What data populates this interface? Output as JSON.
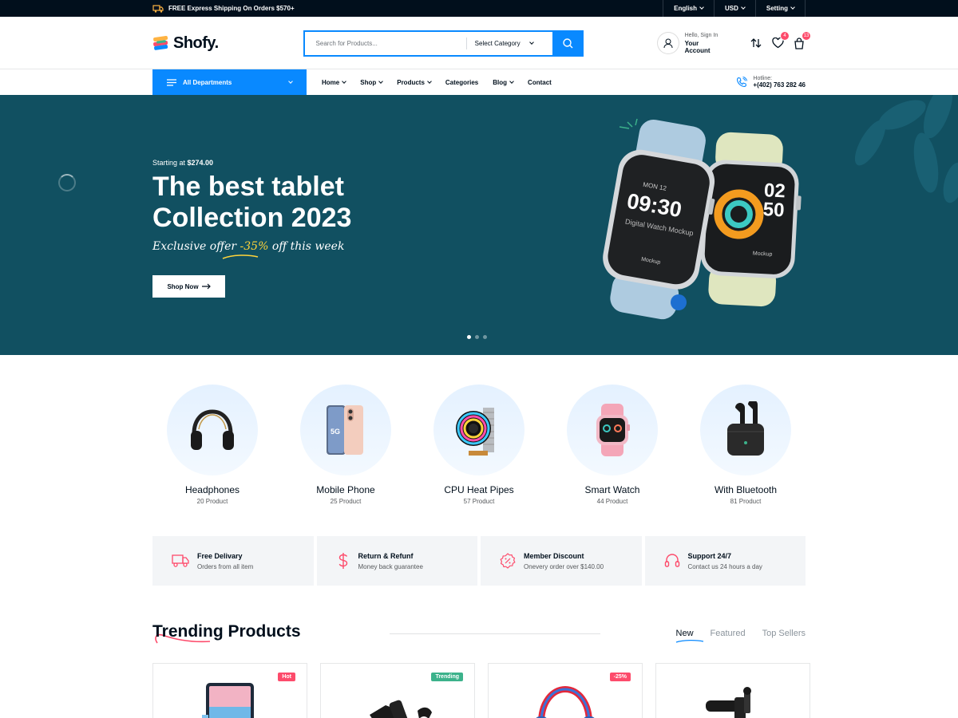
{
  "topbar": {
    "shipping": "FREE Express Shipping On Orders $570+",
    "language": "English",
    "currency": "USD",
    "setting": "Setting"
  },
  "header": {
    "logo": "Shofy.",
    "search_placeholder": "Search for Products...",
    "category": "Select Category",
    "account_line1": "Hello, Sign In",
    "account_line2": "Your Account",
    "wishlist_count": "4",
    "cart_count": "13"
  },
  "nav": {
    "all_departments": "All Departments",
    "menu": [
      "Home",
      "Shop",
      "Products",
      "Categories",
      "Blog",
      "Contact"
    ],
    "hotline_label": "Hotline:",
    "hotline_number": "+(402) 763 282 46"
  },
  "hero": {
    "starting_prefix": "Starting at ",
    "starting_price": "$274.00",
    "title_line1": "The best tablet",
    "title_line2": "Collection 2023",
    "offer_prefix": "Exclusive offer ",
    "offer_pct": "-35%",
    "offer_suffix": " off this week",
    "cta": "Shop Now",
    "watch_left_day": "MON 12",
    "watch_left_time": "09:30",
    "watch_left_caption": "Digital Watch Mockup",
    "watch_left_brand": "Mockup",
    "watch_right_hour": "02",
    "watch_right_min": "50",
    "watch_right_brand": "Mockup",
    "slides": 3,
    "active_slide": 1
  },
  "categories": [
    {
      "name": "Headphones",
      "count": "20 Product",
      "icon": "headphones-icon"
    },
    {
      "name": "Mobile Phone",
      "count": "25 Product",
      "icon": "mobile-phone-icon"
    },
    {
      "name": "CPU Heat Pipes",
      "count": "57 Product",
      "icon": "cpu-cooler-icon"
    },
    {
      "name": "Smart Watch",
      "count": "44 Product",
      "icon": "smart-watch-icon"
    },
    {
      "name": "With Bluetooth",
      "count": "81 Product",
      "icon": "earbuds-icon"
    }
  ],
  "features": [
    {
      "title": "Free Delivary",
      "desc": "Orders from all item",
      "icon": "truck-icon"
    },
    {
      "title": "Return & Refunf",
      "desc": "Money back guarantee",
      "icon": "dollar-icon"
    },
    {
      "title": "Member Discount",
      "desc": "Onevery order over $140.00",
      "icon": "discount-icon"
    },
    {
      "title": "Support 24/7",
      "desc": "Contact us 24 hours a day",
      "icon": "headset-icon"
    }
  ],
  "trending": {
    "title": "Trending Products",
    "tabs": [
      "New",
      "Featured",
      "Top Sellers"
    ],
    "active_tab": "New",
    "products": [
      {
        "tag": "Hot",
        "tag_color": "#fd4b6b",
        "icon": "tablet-icon"
      },
      {
        "tag": "Trending",
        "tag_color": "#3cb28b",
        "icon": "gimbal-icon"
      },
      {
        "tag": "-25%",
        "tag_color": "#fd4b6b",
        "icon": "headphones-icon"
      },
      {
        "tag": "",
        "tag_color": "",
        "icon": "camera-mic-icon"
      }
    ]
  },
  "colors": {
    "accent": "#0989ff",
    "hero_bg": "#115061",
    "dark": "#010f1c",
    "sale": "#fd4b6b",
    "trending": "#3cb28b"
  }
}
